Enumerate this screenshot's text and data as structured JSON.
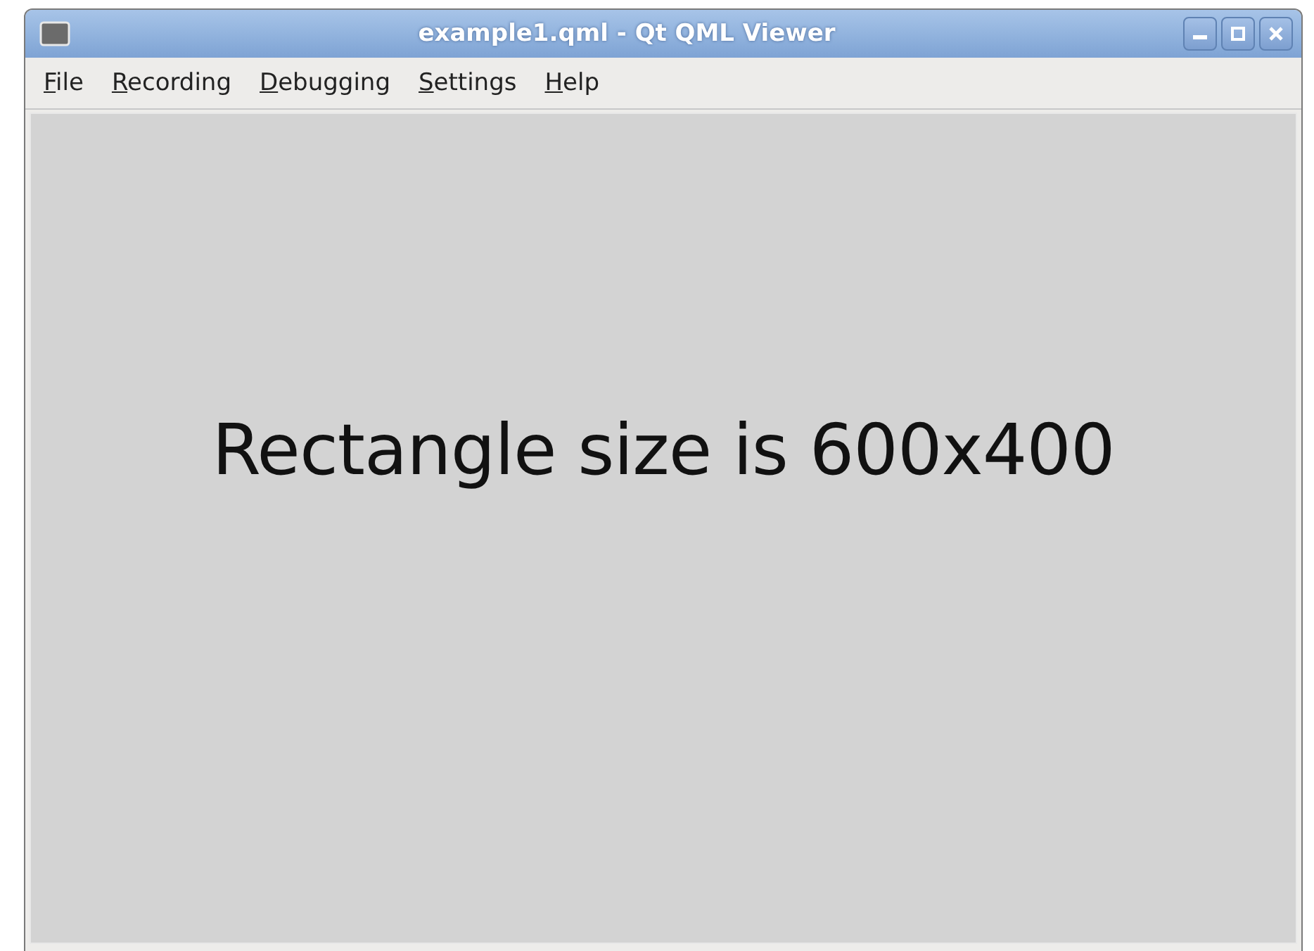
{
  "window": {
    "title": "example1.qml - Qt QML Viewer"
  },
  "menu": [
    "File",
    "Recording",
    "Debugging",
    "Settings",
    "Help"
  ],
  "content": {
    "text": "Rectangle size is 600x400"
  }
}
